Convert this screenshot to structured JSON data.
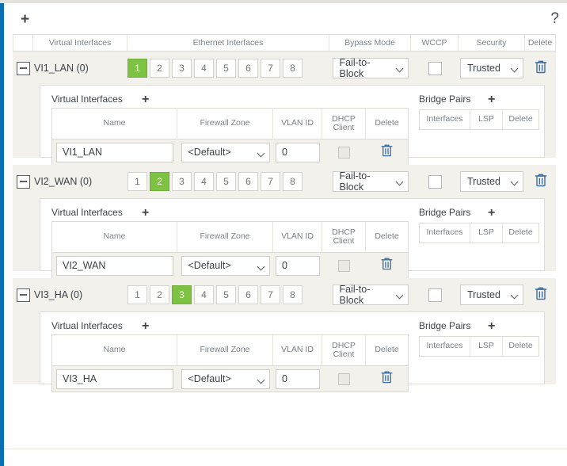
{
  "toolbar": {
    "add_label": "+",
    "help_label": "?"
  },
  "grid": {
    "headers": {
      "expander": "",
      "virtual_interfaces": "Virtual Interfaces",
      "ethernet_interfaces": "Ethernet Interfaces",
      "bypass_mode": "Bypass Mode",
      "wccp": "WCCP",
      "security": "Security",
      "delete": "Delete"
    }
  },
  "inner_labels": {
    "virtual_interfaces": "Virtual Interfaces",
    "virtual_interfaces_add": "+",
    "bridge_pairs": "Bridge Pairs",
    "bridge_pairs_add": "+"
  },
  "inner_vi_headers": {
    "name": "Name",
    "firewall_zone": "Firewall Zone",
    "vlan_id": "VLAN ID",
    "dhcp_client": "DHCP\nClient",
    "dhcp_client_line1": "DHCP",
    "dhcp_client_line2": "Client",
    "delete": "Delete"
  },
  "bridge_pair_headers": {
    "interfaces": "Interfaces",
    "lsp": "LSP",
    "delete": "Delete"
  },
  "ethernet_ports": [
    "1",
    "2",
    "3",
    "4",
    "5",
    "6",
    "7",
    "8"
  ],
  "colors": {
    "active_port": "#7dc242",
    "rail_blue": "#0a6fb5",
    "section_background": "#f2f1ec"
  },
  "sections": [
    {
      "title": "VI1_LAN (0)",
      "active_port": "1",
      "bypass_mode": "Fail-to-Block",
      "wccp_checked": false,
      "security": "Trusted",
      "virtual_interfaces": [
        {
          "name": "VI1_LAN",
          "firewall_zone": "<Default>",
          "vlan_id": "0",
          "dhcp_client": false
        }
      ],
      "bridge_pairs": []
    },
    {
      "title": "VI2_WAN (0)",
      "active_port": "2",
      "bypass_mode": "Fail-to-Block",
      "wccp_checked": false,
      "security": "Trusted",
      "virtual_interfaces": [
        {
          "name": "VI2_WAN",
          "firewall_zone": "<Default>",
          "vlan_id": "0",
          "dhcp_client": false
        }
      ],
      "bridge_pairs": []
    },
    {
      "title": "VI3_HA (0)",
      "active_port": "3",
      "bypass_mode": "Fail-to-Block",
      "wccp_checked": false,
      "security": "Trusted",
      "virtual_interfaces": [
        {
          "name": "VI3_HA",
          "firewall_zone": "<Default>",
          "vlan_id": "0",
          "dhcp_client": false
        }
      ],
      "bridge_pairs": []
    }
  ]
}
